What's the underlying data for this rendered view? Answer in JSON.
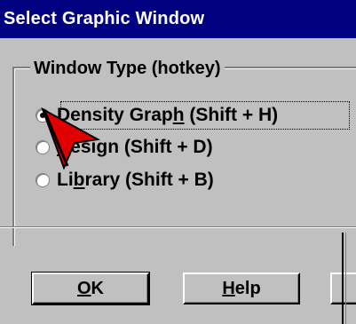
{
  "window": {
    "title": "Select Graphic Window"
  },
  "group": {
    "label": "Window Type (hotkey)"
  },
  "options": [
    {
      "pre": "Density Grap",
      "hot": "h",
      "post": " (Shift + H)",
      "checked": true
    },
    {
      "pre": "",
      "hot": "D",
      "post": "esign (Shift + D)",
      "checked": false
    },
    {
      "pre": "Li",
      "hot": "b",
      "post": "rary (Shift + B)",
      "checked": false
    }
  ],
  "buttons": {
    "ok": {
      "hot": "O",
      "rest": "K"
    },
    "help": {
      "hot": "H",
      "rest": "elp"
    }
  },
  "colors": {
    "titlebar": "#000080",
    "face": "#c0c0c0",
    "pointer": "#e00000"
  }
}
